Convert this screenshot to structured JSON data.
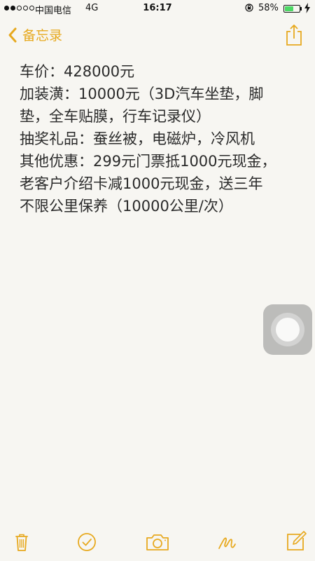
{
  "status_bar": {
    "carrier": "中国电信",
    "network": "4G",
    "time": "16:17",
    "battery_percent": "58%",
    "battery_level": 0.58,
    "signal_bars_filled": 2,
    "signal_bars_total": 5
  },
  "nav": {
    "back_label": "备忘录"
  },
  "note": {
    "lines": [
      "车价：428000元",
      "加装潢：10000元（3D汽车坐垫，脚",
      "垫，全车贴膜，行车记录仪）",
      "抽奖礼品：蚕丝被，电磁炉，冷风机",
      "其他优惠：299元门票抵1000元现金，",
      "老客户介绍卡减1000元现金，送三年",
      "不限公里保养（10000公里/次）"
    ]
  },
  "colors": {
    "accent": "#e7a91f",
    "background": "#f7f6f2",
    "battery": "#4cd964"
  },
  "toolbar": {
    "icons": [
      "trash-icon",
      "checkmark-icon",
      "camera-icon",
      "sketch-icon",
      "compose-icon"
    ]
  }
}
